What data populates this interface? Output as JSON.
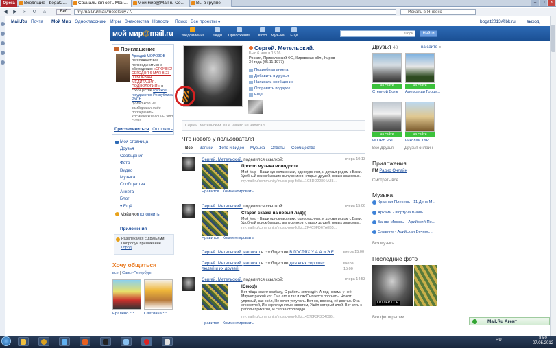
{
  "browser": {
    "opera_label": "Opera",
    "tabs": [
      {
        "label": "Входящие - bogat2..."
      },
      {
        "label": "Социальная сеть Мой..."
      },
      {
        "label": "Мой мир@Mail.ru Со..."
      },
      {
        "label": "Вы в группе"
      }
    ],
    "web_label": "Веб",
    "url": "my.mail.ru/mail/metelskiy77/",
    "search_placeholder": "Искать в Яндекс"
  },
  "sitemenu": [
    "Mail.Ru",
    "Почта",
    "Мой Мир",
    "Одноклассники",
    "Игры",
    "Знакомства",
    "Новости",
    "Поиск",
    "Все проекты"
  ],
  "user": {
    "email": "bogat2013@bk.ru",
    "logout": "выход"
  },
  "header": {
    "logo_a": "мой мир",
    "logo_at": "@",
    "logo_b": "mail.ru",
    "nav": [
      "Уведомления",
      "Люди",
      "Приложения",
      "Фото",
      "Музыка",
      "Ещё"
    ],
    "search_scope": "Люди",
    "find_button": "Найти"
  },
  "invite": {
    "title": "Приглашение",
    "sender": "Аркадий МОРОЗОВ",
    "text1": "приглашает вас",
    "text2": "присоединиться к",
    "text3": "обсуждению",
    "topic": "«СРОЧНО! СЕГОДНЯ 6 МАЯ В 23-00 БОЕВАЯ МЕДИТАЦИЯ. ПОДНОЛОГИЯ!»",
    "text4": "в сообществе",
    "community": "Русское государство Республика РУСЬ",
    "note": "думаю кто не зомбирован надо поддержать! Космические войны это сила!",
    "join": "Присоединиться",
    "decline": "Отклонить"
  },
  "leftmenu": {
    "items": [
      "Моя страница",
      "Друзья",
      "Сообщения",
      "Фото",
      "Видео",
      "Музыка",
      "Сообщества",
      "Анкета",
      "Блог",
      "Ещё"
    ],
    "mailbox": "Мэйлики",
    "replenish": "пополнить",
    "apps": "Приложения"
  },
  "notice": {
    "text": "Развлекайся с друзьями! Попробуй приложение",
    "link": "Город"
  },
  "hochu": {
    "title": "Хочу общаться",
    "tabs": [
      "все",
      "|",
      "Санкт-Петербург"
    ],
    "people": [
      {
        "name": "Ералено ***"
      },
      {
        "name": "Светлана ***"
      }
    ]
  },
  "profile": {
    "name": "Сергей. Метельский.",
    "was": "Был 6 мая в 15:16",
    "location": "Россия, Приволжский ФО, Кировская обл., Киров",
    "age": "34 года (05.11.1977)",
    "links": [
      "Подробная анкета",
      "Добавить в друзья",
      "Написать сообщение",
      "Отправить подарок",
      "Ещё"
    ],
    "status_placeholder": "Сергей. Метельский. еще ничего не написал"
  },
  "feed": {
    "title": "Что нового у пользователя",
    "tabs": [
      "Все",
      "Записи",
      "Фото и видео",
      "Музыка",
      "Ответы",
      "Сообщества"
    ],
    "author": "Сергей. Метельский.",
    "shared_link": "поделился ссылкой:",
    "actions": [
      "Нравится",
      "Комментировать"
    ],
    "posts": [
      {
        "time": "вчера 10:13",
        "title": "Просто музыка молодости.",
        "body": "Мой Мир - Ваши одноклассники, однокурсники, и друзья рядом с Вами. Удобный поиск бывших выпускников, старых друзей, новых знакомых.",
        "url": "my.mail.ru/community/music-pop-folk/...1C5DD22864A38..."
      },
      {
        "time": "вчера 15:06",
        "title": "Старая сказка на новый лад)))",
        "body": "Мой Мир - Ваши одноклассники, однокурсники, и друзья рядом с Вами. Удобный поиск бывших выпускников, старых друзей, новых знакомых.",
        "url": "my.mail.ru/community/music-pop-folk/...2F4C9FD67A0B5..."
      },
      {
        "time": "вчера 14:53",
        "title": "Юмор))",
        "body": "Вот тёща жарит колбасу, С работы зятя ждёт. А под ногами у неё Мяучит рыжий кот. Она его и так и сяк Пытается прогнать, Но кот упрямый, как осёл, Не хочет уступать. Вот он, военец, её достал. Она его метлой, И с горя поднятым хвостом, Ушёл который злой. Вот зять с работы прикатил, И сел за стол гордо...",
        "url": "my.mail.ru/community/music-pop-folk/...4570F3F3D4096..."
      }
    ],
    "lines": [
      {
        "author": "Сергей. Метельский.",
        "verb": "написал",
        "mid": "в сообществе",
        "target": "В ГОСТЯХ У А.А и Э.Е",
        "time": "вчера 15:00"
      },
      {
        "author": "Сергей. Метельский.",
        "verb": "написал",
        "mid": "в сообществе",
        "target": "для всех хороших людей и их друзей!",
        "time": "вчера 15:00"
      }
    ]
  },
  "friends": {
    "title": "Друзья",
    "count": "48",
    "on_site": "на сайте",
    "on_site_count": "5",
    "on_site_label": "на сайте",
    "list": [
      {
        "name": "Степной Волк"
      },
      {
        "name": "Александр Горде..."
      },
      {
        "name": "ИГОРЬ РУС"
      },
      {
        "name": "николай ТУР"
      }
    ],
    "all": "Все друзья",
    "online": "Друзья онлайн"
  },
  "apps_right": {
    "title": "Приложения",
    "item_badge": "FM",
    "item": "Радио Онлайн",
    "all": "Смотреть все"
  },
  "music": {
    "title": "Музыка",
    "tracks": [
      "Красная Плесень - 11 Денс М...",
      "Аркаим - Фортуна Вновь",
      "Банда Москвы - Арийский Пе...",
      "Славяне - Арийская Вечнос..."
    ],
    "all": "Вся музыка"
  },
  "lastphoto": {
    "title": "Последние фото",
    "caption": "ГИТЛЕР ССР",
    "all": "Все фотографии"
  },
  "agent": {
    "label": "Mail.Ru Агент"
  },
  "taskbar": {
    "lang": "RU",
    "time": "8:50",
    "date": "07.05.2012"
  }
}
